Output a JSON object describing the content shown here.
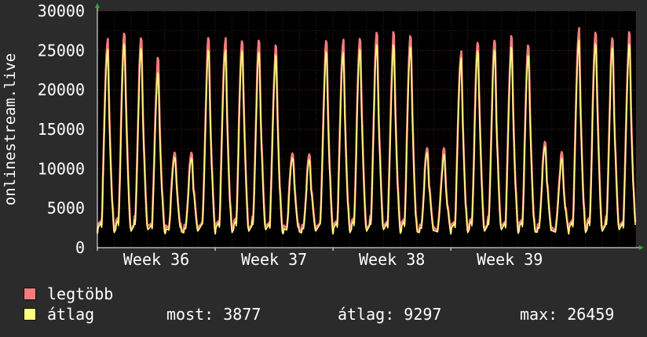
{
  "chart_data": {
    "type": "line",
    "ylabel": "onlinestream.live",
    "ylim": [
      0,
      30000
    ],
    "yticks": [
      0,
      5000,
      10000,
      15000,
      20000,
      25000,
      30000
    ],
    "xticks": [
      "Week 36",
      "Week 37",
      "Week 38",
      "Week 39"
    ],
    "grid": true,
    "legend": "bottom",
    "series": [
      {
        "name": "legtöbb",
        "color": "#f47c7c",
        "daily_peaks": [
          26600,
          27700,
          26800,
          24000,
          12500,
          12200,
          26700,
          26700,
          26700,
          26500,
          25600,
          12400,
          12000,
          26300,
          26500,
          27000,
          27500,
          27300,
          27500,
          12800,
          12500,
          25000,
          26500,
          26500,
          26800,
          26300,
          13600,
          12000,
          28000,
          27800,
          26800,
          27300
        ]
      },
      {
        "name": "átlag",
        "color": "#ffff80",
        "daily_peaks": [
          25400,
          26300,
          25500,
          22200,
          11800,
          11500,
          25200,
          25300,
          25400,
          25000,
          24500,
          11700,
          11300,
          25000,
          25000,
          25600,
          26000,
          25800,
          26000,
          12200,
          11800,
          24300,
          25400,
          25300,
          25500,
          24900,
          13000,
          11300,
          26600,
          26300,
          25600,
          25900
        ]
      }
    ]
  },
  "legend": {
    "max_label": "legtöbb",
    "avg_label": "átlag",
    "now": "most: 3877",
    "average": "átlag: 9297",
    "maximum": "max: 26459"
  },
  "colors": {
    "background": "#2b2b2b",
    "plot": "#000000",
    "grid": "#5a2a2a",
    "axis": "#ffffff"
  }
}
